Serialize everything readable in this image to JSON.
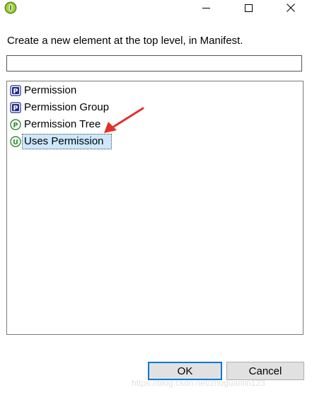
{
  "window": {
    "icon": "android-eclipse-icon",
    "controls": {
      "minimize_icon": "minimize-icon",
      "maximize_icon": "maximize-icon",
      "close_icon": "close-icon"
    }
  },
  "dialog": {
    "prompt": "Create a new element at the top level, in Manifest.",
    "filter": {
      "value": "",
      "placeholder": ""
    },
    "items": [
      {
        "label": "Permission",
        "icon": "p-square-icon",
        "selected": false
      },
      {
        "label": "Permission Group",
        "icon": "p-square-icon",
        "selected": false
      },
      {
        "label": "Permission Tree",
        "icon": "p-circle-icon",
        "selected": false
      },
      {
        "label": "Uses Permission",
        "icon": "u-circle-icon",
        "selected": true
      }
    ],
    "ok_label": "OK",
    "cancel_label": "Cancel"
  },
  "annotation": {
    "type": "red-arrow",
    "color": "#e5302a"
  },
  "watermark": "https://blog.csdn.net/zhuguanlin123",
  "colors": {
    "selection": "#cce8ff",
    "default_button_border": "#0078d7",
    "button_face": "#e1e1e1"
  }
}
